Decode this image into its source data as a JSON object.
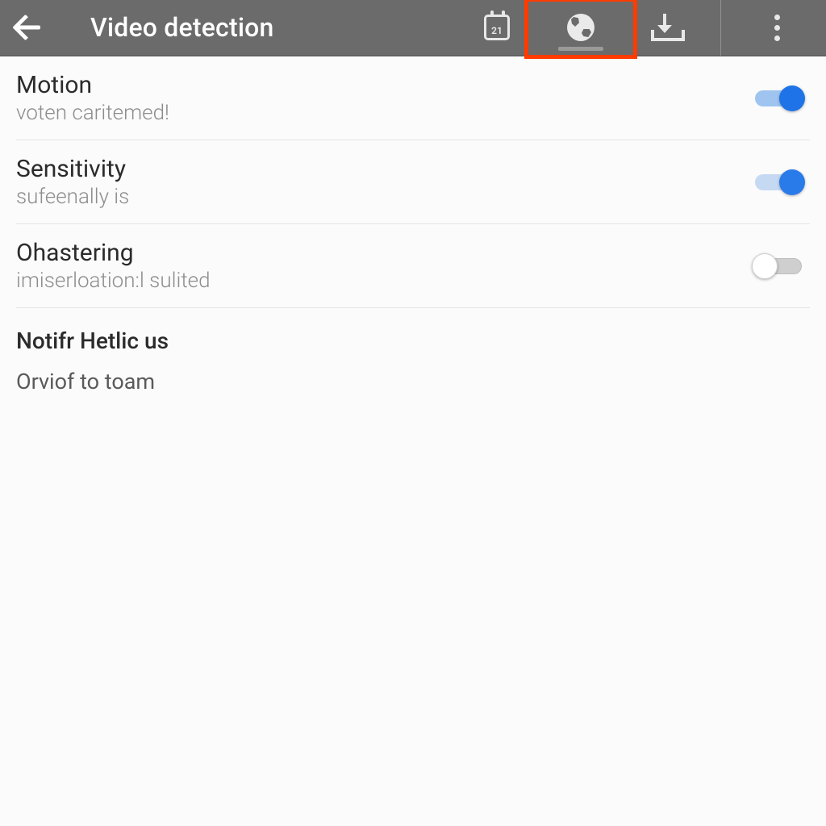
{
  "appbar": {
    "title": "Video detection",
    "calendar_day": "21"
  },
  "rows": {
    "motion": {
      "title": "Motion",
      "subtitle": "voten caritemed!",
      "on": true
    },
    "sensitivity": {
      "title": "Sensitivity",
      "subtitle": "sufeenally is",
      "on": true
    },
    "ohastering": {
      "title": "Ohastering",
      "subtitle": "imiserloation:l sulited",
      "on": false
    }
  },
  "section": {
    "header": "Notifr Hetlic us",
    "line": "Orviof to toam"
  }
}
